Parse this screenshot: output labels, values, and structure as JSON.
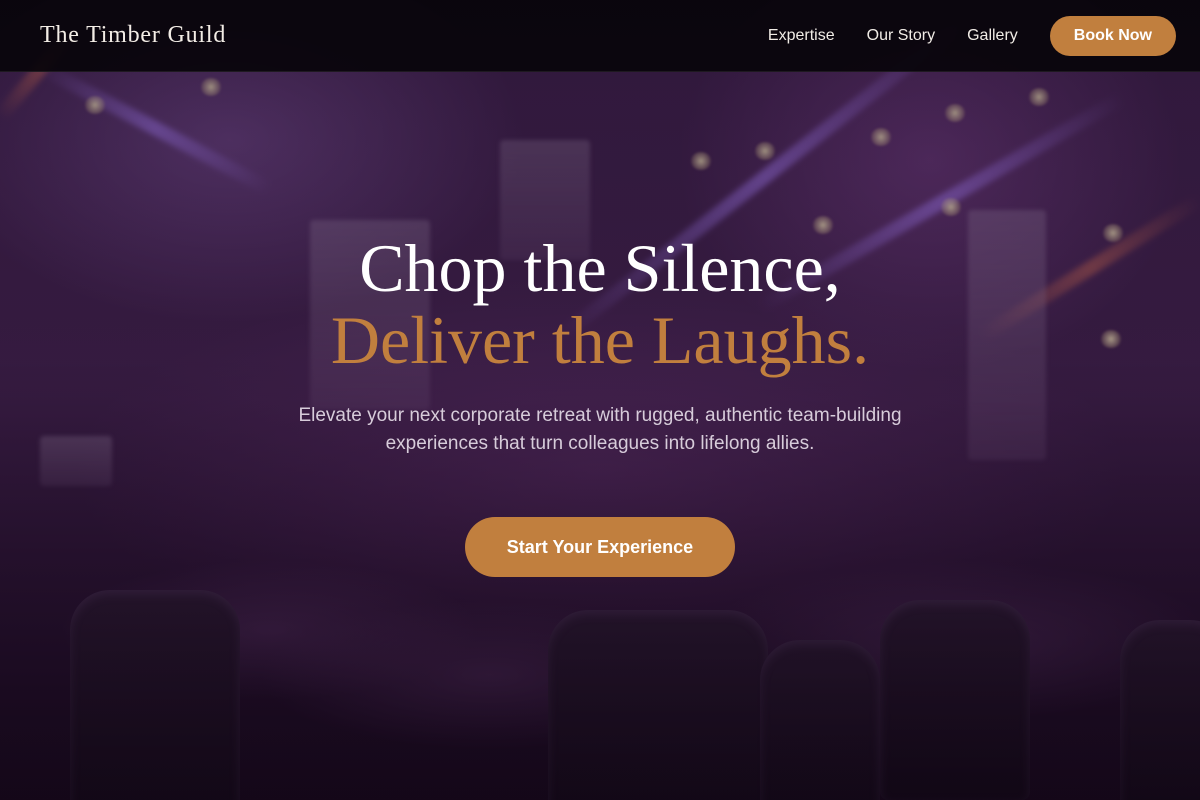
{
  "brand": {
    "name": "The Timber Guild"
  },
  "nav": {
    "links": [
      "Expertise",
      "Our Story",
      "Gallery"
    ],
    "cta_label": "Book Now"
  },
  "hero": {
    "headline_line1": "Chop the Silence,",
    "headline_line2": "Deliver the Laughs.",
    "subtitle": "Elevate your next corporate retreat with rugged, authentic team-building experiences that turn colleagues into lifelong allies.",
    "cta_label": "Start Your Experience",
    "background_image": "event-hall-stage-lights-icon"
  },
  "colors": {
    "accent": "#c17f3e",
    "navbar_bg": "#08040a",
    "headline_white": "#ffffff",
    "subtitle_text": "#d7ccda"
  }
}
